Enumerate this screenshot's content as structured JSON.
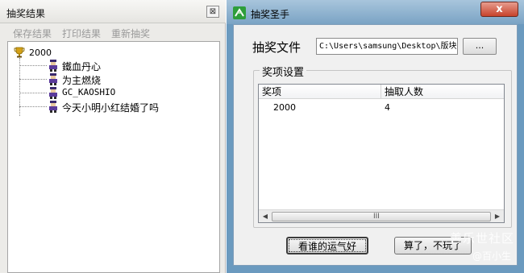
{
  "left_window": {
    "title": "抽奖结果",
    "close_glyph": "⊠",
    "menu": [
      "保存结果",
      "打印结果",
      "重新抽奖"
    ],
    "tree": {
      "root": "2000",
      "winners": [
        "鐵血丹心",
        "为主燃烧",
        "GC_KAOSHIO",
        "今天小明小红结婚了吗"
      ]
    }
  },
  "right_window": {
    "title": "抽奖圣手",
    "close_glyph": "x",
    "file_label": "抽奖文件",
    "file_path": "C:\\Users\\samsung\\Desktop\\版块",
    "browse_label": "...",
    "group_title": "奖项设置",
    "list": {
      "columns": [
        "奖项",
        "抽取人数"
      ],
      "rows": [
        [
          "2000",
          "4"
        ]
      ]
    },
    "scroll_grip": "III",
    "lucky_button": "看谁的运气好",
    "quit_button": "算了，不玩了"
  },
  "watermark": {
    "site": "善乐世社区",
    "author": "@百小生"
  },
  "colors": {
    "trophy": "#d4a017",
    "app_icon": "#2e9e3b",
    "close_red": "#c7432c",
    "frame_blue": "#6b9abf"
  },
  "icons": {
    "trophy": "trophy-icon",
    "winner": "person-icon",
    "app": "app-icon"
  }
}
